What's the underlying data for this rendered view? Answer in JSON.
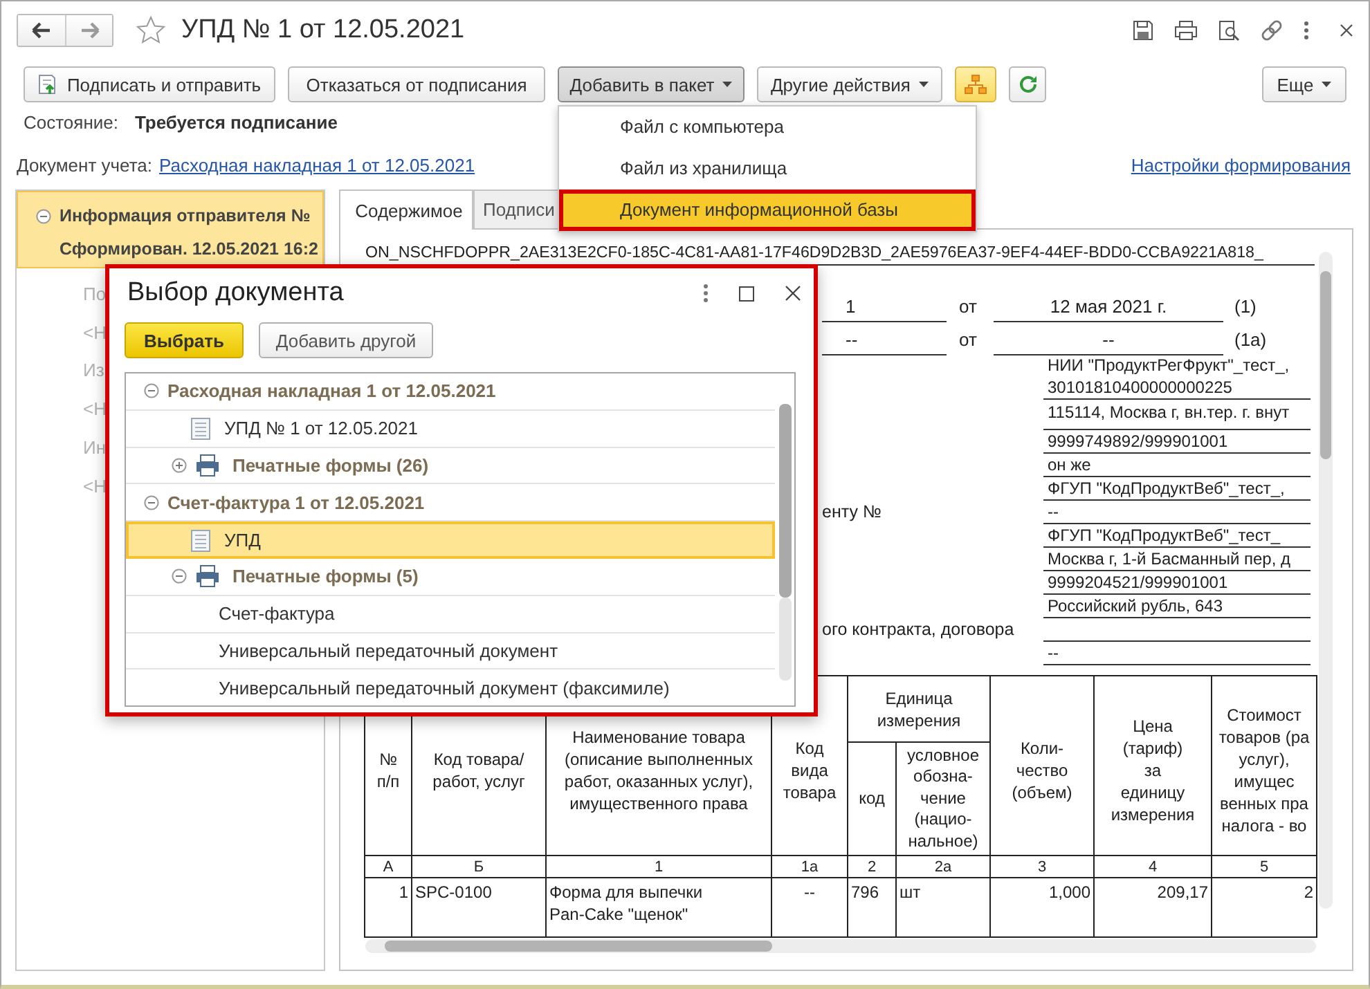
{
  "window": {
    "title": "УПД № 1 от 12.05.2021"
  },
  "toolbar": [
    {
      "kind": "sign",
      "label": "Подписать и отправить"
    },
    {
      "kind": "button",
      "label": "Отказаться от подписания"
    },
    {
      "kind": "menu",
      "label": "Добавить в пакет",
      "expanded": true
    },
    {
      "kind": "menu",
      "label": "Другие действия",
      "expanded": false
    },
    {
      "kind": "toggle",
      "on": true
    },
    {
      "kind": "refresh"
    }
  ],
  "toolbar_right": [
    {
      "kind": "menu",
      "label": "Еще",
      "expanded": false
    }
  ],
  "state": {
    "label": "Состояние:",
    "value": "Требуется подписание"
  },
  "document_link": {
    "label": "Документ учета:",
    "link": "Расходная накладная 1 от 12.05.2021"
  },
  "settings_link": "Настройки формирования",
  "add_menu": [
    {
      "label": "Файл с компьютера",
      "selected": false
    },
    {
      "label": "Файл из хранилища",
      "selected": false
    },
    {
      "label": "Документ информационной базы",
      "selected": true
    }
  ],
  "left_tree": [
    {
      "title": "Информация отправителя №",
      "status": "Сформирован. 12.05.2021 16:2",
      "expanded": true,
      "selected": true,
      "children": [
        {
          "label": "По",
          "selected": false
        },
        {
          "label": "<Н",
          "selected": false
        },
        {
          "label": "Из",
          "selected": false
        },
        {
          "label": "<Н",
          "selected": false
        },
        {
          "label": "Ин",
          "selected": false
        },
        {
          "label": "<Н",
          "selected": false
        }
      ]
    }
  ],
  "tabs": [
    {
      "label": "Содержимое",
      "selected": true
    },
    {
      "label": "Подписи",
      "selected": false
    }
  ],
  "document": {
    "file_name": "ON_NSCHFDOPPR_2AE313E2CF0-185C-4C81-AA81-17F46D9D2B3D_2AE5976EA37-9EF4-44EF-BDD0-CCBA9221A818_",
    "number_rows": [
      {
        "number": "1",
        "from": "от",
        "date": "12 мая 2021 г.",
        "ref": "(1)"
      },
      {
        "number": "--",
        "from": "от",
        "date": "--",
        "ref": "(1а)"
      }
    ],
    "details": [
      {
        "value": "НИИ \"ПродуктРегФрукт\"_тест_,\n30101810400000000225"
      },
      {
        "value": "115114, Москва г, вн.тер. г. внут"
      },
      {
        "value": "9999749892/999901001"
      },
      {
        "value": "он же"
      },
      {
        "value": "ФГУП \"КодПродуктВеб\"_тест_,"
      },
      {
        "label": "енту №",
        "value": "--"
      },
      {
        "value": "ФГУП \"КодПродуктВеб\"_тест_"
      },
      {
        "value": "Москва г, 1-й Басманный пер, д"
      },
      {
        "value": "9999204521/999901001"
      },
      {
        "value": "Российский рубль, 643"
      },
      {
        "label": "ого контракта, договора"
      },
      {
        "value": "--"
      }
    ],
    "columns": [
      {
        "kind": "single",
        "header": "№\nп/п",
        "index": "А"
      },
      {
        "kind": "single",
        "header": "Код товара/\nработ, услуг",
        "index": "Б"
      },
      {
        "kind": "single",
        "header": "Наименование товара\n(описание выполненных\nработ, оказанных услуг),\nимущественного права",
        "index": "1"
      },
      {
        "kind": "single",
        "header": "Код\nвида\nтовара",
        "index": "1а"
      },
      {
        "kind": "unit",
        "header": "код",
        "index": "2"
      },
      {
        "kind": "unit",
        "header": "условное\nобозна-\nчение\n(нацио-\nнальное)",
        "index": "2а"
      },
      {
        "kind": "single",
        "header": "Коли-\nчество\n(объем)",
        "index": "3"
      },
      {
        "kind": "single",
        "header": "Цена\n(тариф)\nза\nединицу\nизмерения",
        "index": "4"
      },
      {
        "kind": "single",
        "header": "Стоимост\nтоваров (ра\nуслуг),\nимущес\nвенных пра\nналога - во",
        "index": "5"
      }
    ],
    "column_groups": [
      {
        "header": "Единица\nизмерения"
      }
    ],
    "rows": [
      [
        "1",
        "SPC-0100",
        "Форма для выпечки\nPan-Cake \"щенок\"",
        "--",
        "796",
        "шт",
        "1,000",
        "209,17",
        "2"
      ]
    ]
  },
  "dialog": {
    "title": "Выбор документа",
    "buttons": [
      {
        "kind": "primary",
        "label": "Выбрать"
      },
      {
        "kind": "default",
        "label": "Добавить другой"
      }
    ],
    "items": [
      {
        "kind": "group",
        "label": "Расходная накладная 1 от 12.05.2021",
        "expanded": true,
        "selected": false,
        "children": [
          {
            "kind": "document",
            "label": "УПД № 1 от 12.05.2021",
            "selected": false
          },
          {
            "kind": "print-forms",
            "label": "Печатные формы (26)",
            "expanded": false,
            "selected": false
          }
        ]
      },
      {
        "kind": "group",
        "label": "Счет-фактура 1 от 12.05.2021",
        "expanded": true,
        "selected": false,
        "children": [
          {
            "kind": "document",
            "label": "УПД",
            "selected": true
          },
          {
            "kind": "print-forms",
            "label": "Печатные формы (5)",
            "expanded": true,
            "selected": false,
            "children": [
              {
                "kind": "form",
                "label": "Счет-фактура",
                "selected": false
              },
              {
                "kind": "form",
                "label": "Универсальный передаточный документ",
                "selected": false
              },
              {
                "kind": "form",
                "label": "Универсальный передаточный документ (факсимиле)",
                "selected": false
              }
            ]
          }
        ]
      }
    ]
  }
}
